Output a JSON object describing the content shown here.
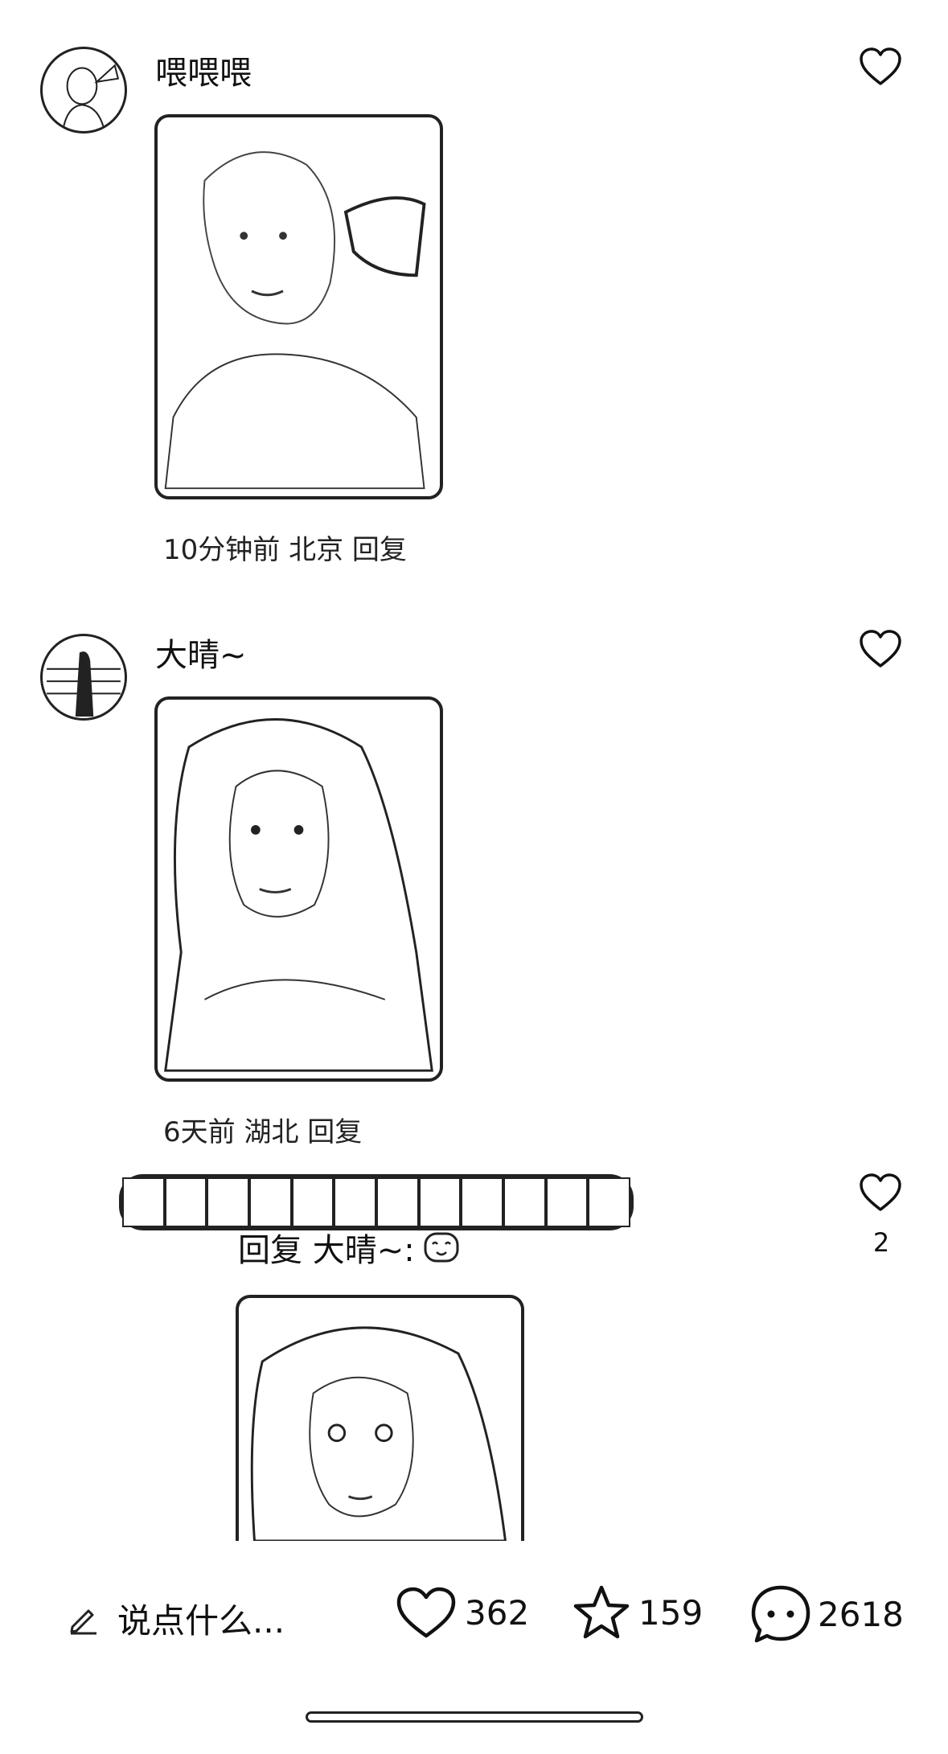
{
  "comments": [
    {
      "username": "喂喂喂",
      "meta": "10分钟前 北京 回复"
    },
    {
      "username": "大晴~",
      "meta": "6天前 湖北 回复",
      "reply": {
        "text": "回复 大晴~:",
        "like_count": "2"
      }
    }
  ],
  "bottom_bar": {
    "input_placeholder": "说点什么...",
    "likes": "362",
    "favorites": "159",
    "comments": "2618"
  },
  "icons": {
    "like": "heart-icon",
    "favorite": "star-icon",
    "comment": "chat-bubble-icon",
    "edit": "pencil-icon"
  }
}
